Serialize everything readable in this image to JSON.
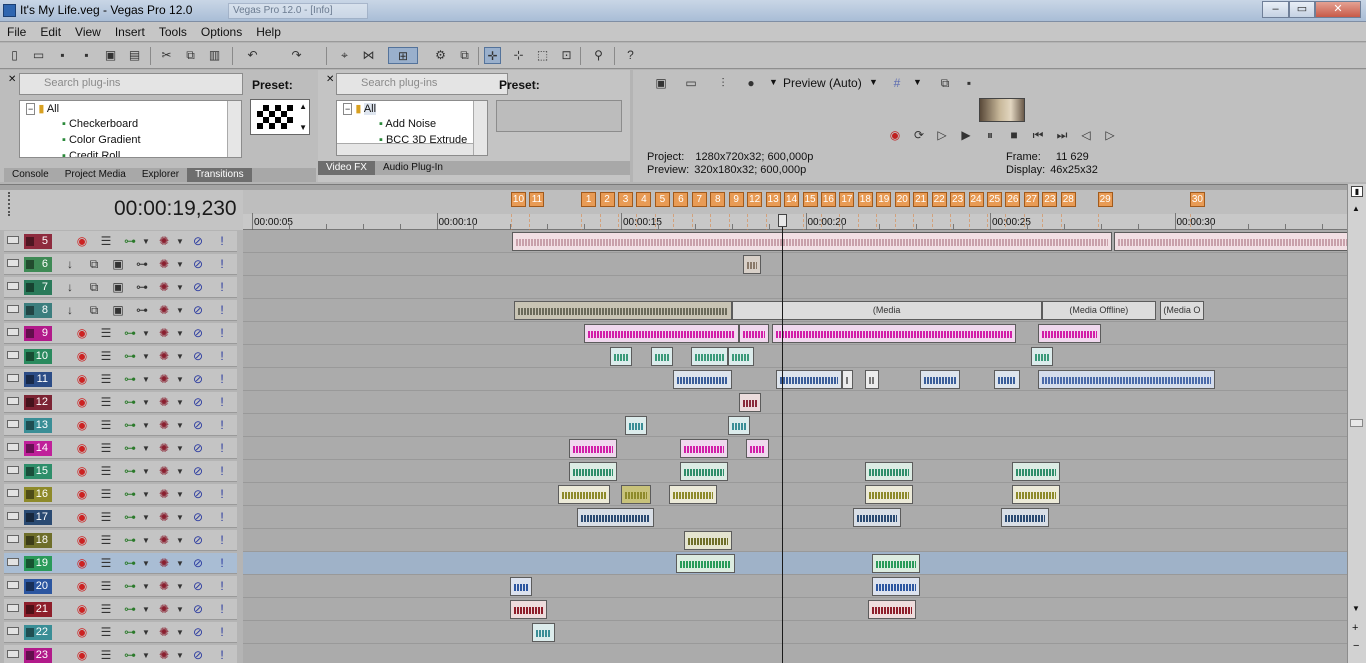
{
  "window": {
    "title": "It's My Life.veg - Vegas Pro 12.0",
    "ghost_tab": "Vegas Pro 12.0 - [Info]",
    "min": "‒",
    "max": "▭",
    "close": "✕"
  },
  "menu": [
    "File",
    "Edit",
    "View",
    "Insert",
    "Tools",
    "Options",
    "Help"
  ],
  "transitions_panel": {
    "search_placeholder": "Search plug-ins",
    "preset_label": "Preset:",
    "tree": [
      "All",
      "Checkerboard",
      "Color Gradient",
      "Credit Roll"
    ],
    "tabs": [
      "Console",
      "Project Media",
      "Explorer",
      "Transitions"
    ]
  },
  "videofx_panel": {
    "search_placeholder": "Search plug-ins",
    "preset_label": "Preset:",
    "tree": [
      "All",
      "Add Noise",
      "BCC 3D Extrude"
    ],
    "tabs": [
      "Video FX",
      "Audio Plug-In"
    ]
  },
  "preview": {
    "mode": "Preview (Auto)",
    "project_label": "Project:",
    "project_value": "1280x720x32; 600,000p",
    "preview_label": "Preview:",
    "preview_value": "320x180x32; 600,000p",
    "frame_label": "Frame:",
    "frame_value": "11 629",
    "display_label": "Display:",
    "display_value": "46x25x32"
  },
  "timecode": "00:00:19,230",
  "ruler": {
    "labels": [
      "00:00:05",
      "00:00:10",
      "00:00:15",
      "00:00:20",
      "00:00:25",
      "00:00:30"
    ],
    "times": [
      5,
      10,
      15,
      20,
      25,
      30
    ]
  },
  "markers": [
    "10",
    "11",
    "1",
    "2",
    "3",
    "4",
    "5",
    "6",
    "7",
    "8",
    "9",
    "12",
    "13",
    "14",
    "15",
    "16",
    "17",
    "18",
    "19",
    "20",
    "21",
    "22",
    "23",
    "24",
    "25",
    "26",
    "27",
    "23",
    "28",
    "29",
    "30"
  ],
  "markers_t": [
    12.1,
    12.6,
    14.0,
    14.5,
    15.0,
    15.5,
    16.0,
    16.5,
    17.0,
    17.5,
    18.0,
    18.5,
    19.0,
    19.5,
    20.0,
    20.5,
    21.0,
    21.5,
    22.0,
    22.5,
    23.0,
    23.5,
    24.0,
    24.5,
    25.0,
    25.5,
    26.0,
    26.5,
    27.0,
    28.0,
    30.5
  ],
  "tracks": [
    {
      "num": "5",
      "color": "#8e2b3e",
      "type": "audio"
    },
    {
      "num": "6",
      "color": "#3e8a55",
      "type": "video"
    },
    {
      "num": "7",
      "color": "#2a7a5a",
      "type": "video"
    },
    {
      "num": "8",
      "color": "#3c7e7e",
      "type": "video"
    },
    {
      "num": "9",
      "color": "#b21a8a",
      "type": "audio"
    },
    {
      "num": "10",
      "color": "#2a8a5e",
      "type": "audio"
    },
    {
      "num": "11",
      "color": "#2c4c86",
      "type": "audio"
    },
    {
      "num": "12",
      "color": "#7c2434",
      "type": "audio"
    },
    {
      "num": "13",
      "color": "#3a8e96",
      "type": "audio"
    },
    {
      "num": "14",
      "color": "#c0209a",
      "type": "audio"
    },
    {
      "num": "15",
      "color": "#2e8e6a",
      "type": "audio"
    },
    {
      "num": "16",
      "color": "#8e8a2a",
      "type": "audio"
    },
    {
      "num": "17",
      "color": "#2a4a72",
      "type": "audio"
    },
    {
      "num": "18",
      "color": "#6e6e2a",
      "type": "audio"
    },
    {
      "num": "19",
      "color": "#2a9a5a",
      "type": "audio",
      "selected": true
    },
    {
      "num": "20",
      "color": "#2c56a0",
      "type": "audio"
    },
    {
      "num": "21",
      "color": "#8e1e2a",
      "type": "audio"
    },
    {
      "num": "22",
      "color": "#3a8e96",
      "type": "audio"
    },
    {
      "num": "23",
      "color": "#b21a8a",
      "type": "audio"
    }
  ],
  "clips": [
    {
      "lane": 0,
      "t0": 12.05,
      "t1": 28.3,
      "color": "#f2dfe4",
      "wave": "#c8a0aa"
    },
    {
      "lane": 0,
      "t0": 28.35,
      "t1": 35.0,
      "color": "#f2dfe4",
      "wave": "#c8a0aa"
    },
    {
      "lane": 1,
      "t0": 18.3,
      "t1": 18.8,
      "color": "#d8d0c8",
      "wave": "#8a7a6a"
    },
    {
      "lane": 3,
      "t0": 12.1,
      "t1": 18.0,
      "color": "#c8c4b4",
      "wave": "#6a6a5a"
    },
    {
      "lane": 3,
      "t0": 18.0,
      "t1": 26.4,
      "color": "#dcdcdc",
      "wave": "#dcdcdc",
      "label": "(Media"
    },
    {
      "lane": 3,
      "t0": 26.4,
      "t1": 29.5,
      "color": "#dcdcdc",
      "wave": "#dcdcdc",
      "label": "(Media Offline)"
    },
    {
      "lane": 3,
      "t0": 29.6,
      "t1": 30.8,
      "color": "#dcdcdc",
      "wave": "#dcdcdc",
      "label": "(Media O"
    },
    {
      "lane": 4,
      "t0": 14.0,
      "t1": 18.2,
      "color": "#f0d8ee",
      "wave": "#d21ea8"
    },
    {
      "lane": 4,
      "t0": 18.2,
      "t1": 19.0,
      "color": "#f0d8ee",
      "wave": "#d21ea8"
    },
    {
      "lane": 4,
      "t0": 19.1,
      "t1": 25.7,
      "color": "#f0d8ee",
      "wave": "#d21ea8"
    },
    {
      "lane": 4,
      "t0": 26.3,
      "t1": 28.0,
      "color": "#f0d8ee",
      "wave": "#d21ea8"
    },
    {
      "lane": 5,
      "t0": 14.7,
      "t1": 15.3,
      "color": "#dcecec",
      "wave": "#3a9a7a"
    },
    {
      "lane": 5,
      "t0": 15.8,
      "t1": 16.4,
      "color": "#dcecec",
      "wave": "#3a9a7a"
    },
    {
      "lane": 5,
      "t0": 16.9,
      "t1": 17.9,
      "color": "#dcecec",
      "wave": "#3a9a7a"
    },
    {
      "lane": 5,
      "t0": 17.9,
      "t1": 18.6,
      "color": "#dcecec",
      "wave": "#3a9a7a"
    },
    {
      "lane": 5,
      "t0": 26.1,
      "t1": 26.7,
      "color": "#dcecec",
      "wave": "#3a9a7a"
    },
    {
      "lane": 6,
      "t0": 16.4,
      "t1": 18.0,
      "color": "#dde4ec",
      "wave": "#3a5e9a"
    },
    {
      "lane": 6,
      "t0": 19.2,
      "t1": 21.0,
      "color": "#dde4ec",
      "wave": "#3a5e9a"
    },
    {
      "lane": 6,
      "t0": 21.0,
      "t1": 21.3,
      "color": "#ececec",
      "wave": "#777"
    },
    {
      "lane": 6,
      "t0": 21.6,
      "t1": 22.0,
      "color": "#ececec",
      "wave": "#777"
    },
    {
      "lane": 6,
      "t0": 23.1,
      "t1": 24.2,
      "color": "#dde4ec",
      "wave": "#3a5e9a"
    },
    {
      "lane": 6,
      "t0": 25.1,
      "t1": 25.8,
      "color": "#dde4ec",
      "wave": "#3a5e9a"
    },
    {
      "lane": 6,
      "t0": 26.3,
      "t1": 31.1,
      "color": "#d4dcec",
      "wave": "#4a6aaa"
    },
    {
      "lane": 7,
      "t0": 18.2,
      "t1": 18.8,
      "color": "#ecdcdc",
      "wave": "#8a2a3a"
    },
    {
      "lane": 8,
      "t0": 15.1,
      "t1": 15.7,
      "color": "#dcecec",
      "wave": "#3a8e96"
    },
    {
      "lane": 8,
      "t0": 17.9,
      "t1": 18.5,
      "color": "#dcecec",
      "wave": "#3a8e96"
    },
    {
      "lane": 9,
      "t0": 13.6,
      "t1": 14.9,
      "color": "#f0d8ee",
      "wave": "#d21ea8"
    },
    {
      "lane": 9,
      "t0": 16.6,
      "t1": 17.9,
      "color": "#f0d8ee",
      "wave": "#d21ea8"
    },
    {
      "lane": 9,
      "t0": 18.4,
      "t1": 19.0,
      "color": "#f0d8ee",
      "wave": "#d21ea8"
    },
    {
      "lane": 10,
      "t0": 13.6,
      "t1": 14.9,
      "color": "#dcece4",
      "wave": "#2e8e6a"
    },
    {
      "lane": 10,
      "t0": 16.6,
      "t1": 17.9,
      "color": "#dcece4",
      "wave": "#2e8e6a"
    },
    {
      "lane": 10,
      "t0": 21.6,
      "t1": 22.9,
      "color": "#dcece4",
      "wave": "#2e8e6a"
    },
    {
      "lane": 10,
      "t0": 25.6,
      "t1": 26.9,
      "color": "#dcece4",
      "wave": "#2e8e6a"
    },
    {
      "lane": 11,
      "t0": 13.3,
      "t1": 14.7,
      "color": "#ecead8",
      "wave": "#8e8a2a"
    },
    {
      "lane": 11,
      "t0": 15.0,
      "t1": 15.8,
      "color": "#c8c27a",
      "wave": "#8e8a2a"
    },
    {
      "lane": 11,
      "t0": 16.3,
      "t1": 17.6,
      "color": "#ecead8",
      "wave": "#8e8a2a"
    },
    {
      "lane": 11,
      "t0": 21.6,
      "t1": 22.9,
      "color": "#ecead8",
      "wave": "#8e8a2a"
    },
    {
      "lane": 11,
      "t0": 25.6,
      "t1": 26.9,
      "color": "#ecead8",
      "wave": "#8e8a2a"
    },
    {
      "lane": 12,
      "t0": 13.8,
      "t1": 15.9,
      "color": "#d8dee6",
      "wave": "#2a4a72"
    },
    {
      "lane": 12,
      "t0": 21.3,
      "t1": 22.6,
      "color": "#d8dee6",
      "wave": "#2a4a72"
    },
    {
      "lane": 12,
      "t0": 25.3,
      "t1": 26.6,
      "color": "#d8dee6",
      "wave": "#2a4a72"
    },
    {
      "lane": 13,
      "t0": 16.7,
      "t1": 18.0,
      "color": "#e4e4d0",
      "wave": "#6e6e2a"
    },
    {
      "lane": 14,
      "t0": 16.5,
      "t1": 18.1,
      "color": "#dcece0",
      "wave": "#2a9a5a"
    },
    {
      "lane": 14,
      "t0": 21.8,
      "t1": 23.1,
      "color": "#dcece0",
      "wave": "#2a9a5a"
    },
    {
      "lane": 15,
      "t0": 12.0,
      "t1": 12.6,
      "color": "#dce2ee",
      "wave": "#2c56a0"
    },
    {
      "lane": 15,
      "t0": 21.8,
      "t1": 23.1,
      "color": "#dce2ee",
      "wave": "#2c56a0"
    },
    {
      "lane": 16,
      "t0": 12.0,
      "t1": 13.0,
      "color": "#eedcdc",
      "wave": "#8e1e2a"
    },
    {
      "lane": 16,
      "t0": 21.7,
      "t1": 23.0,
      "color": "#eedcdc",
      "wave": "#8e1e2a"
    },
    {
      "lane": 17,
      "t0": 12.6,
      "t1": 13.2,
      "color": "#dcecec",
      "wave": "#3a8e96"
    }
  ]
}
